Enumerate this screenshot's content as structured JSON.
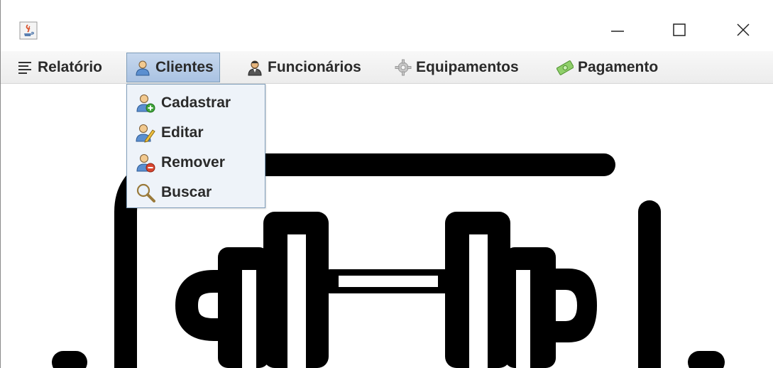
{
  "window": {
    "app_icon": "java-cup-icon",
    "controls": [
      "minimize-icon",
      "maximize-icon",
      "close-icon"
    ]
  },
  "menubar": {
    "items": [
      {
        "label": "Relatório",
        "icon": "list-lines-icon"
      },
      {
        "label": "Clientes",
        "icon": "user-icon",
        "active": true
      },
      {
        "label": "Funcionários",
        "icon": "worker-icon"
      },
      {
        "label": "Equipamentos",
        "icon": "gear-icon"
      },
      {
        "label": "Pagamento",
        "icon": "money-icon"
      }
    ]
  },
  "dropdown": {
    "items": [
      {
        "label": "Cadastrar",
        "icon": "user-add-icon"
      },
      {
        "label": "Editar",
        "icon": "user-edit-icon"
      },
      {
        "label": "Remover",
        "icon": "user-remove-icon"
      },
      {
        "label": "Buscar",
        "icon": "magnifier-icon"
      }
    ]
  },
  "content": {
    "image": "dumbbell-gym-icon"
  },
  "colors": {
    "menu_active": "#b8cde8",
    "menu_border": "#7f9db9",
    "dropdown_bg": "#eef3f9",
    "artwork": "#000000"
  }
}
